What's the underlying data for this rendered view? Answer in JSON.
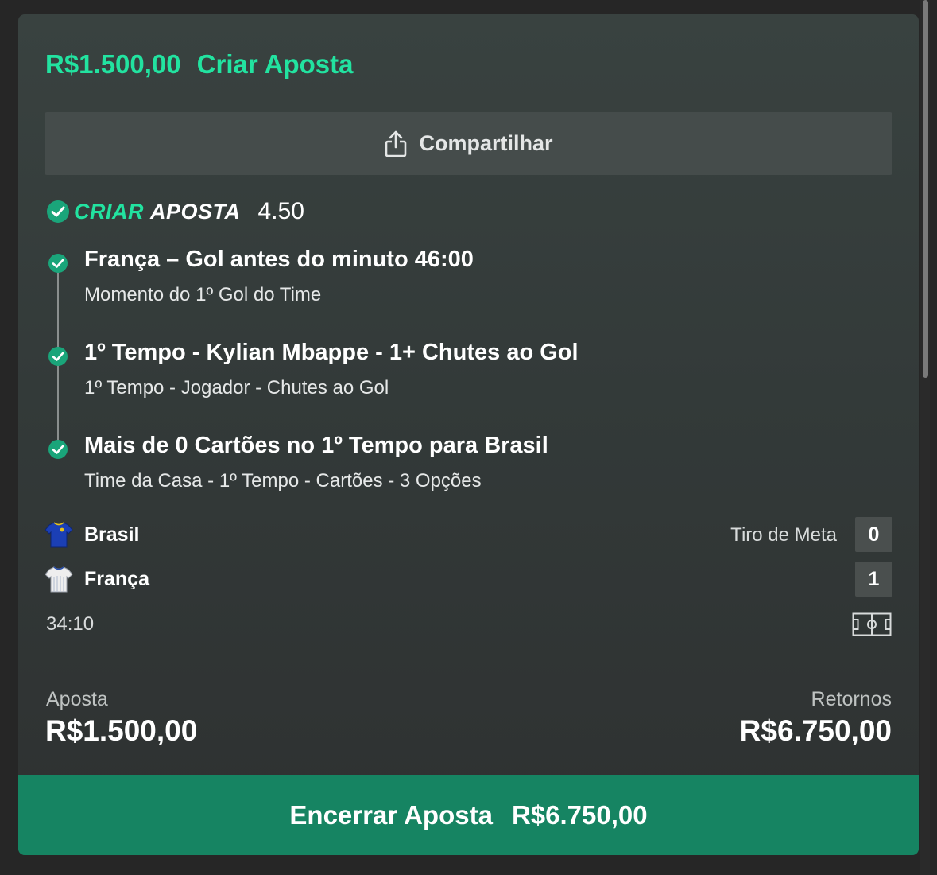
{
  "header": {
    "amount": "R$1.500,00",
    "title": "Criar Aposta"
  },
  "share_button": {
    "label": "Compartilhar",
    "icon": "share-icon"
  },
  "bet_builder": {
    "badge_word1": "CRIAR",
    "badge_word2": "APOSTA",
    "odds": "4.50",
    "icon": "check-circle-icon"
  },
  "selections": [
    {
      "title": "França – Gol antes do minuto 46:00",
      "subtitle": "Momento do 1º Gol do Time"
    },
    {
      "title": "1º Tempo - Kylian Mbappe - 1+ Chutes ao Gol",
      "subtitle": "1º Tempo - Jogador - Chutes ao Gol"
    },
    {
      "title": "Mais de 0 Cartões no 1º Tempo para Brasil",
      "subtitle": "Time da Casa - 1º Tempo - Cartões - 3 Opções"
    }
  ],
  "match": {
    "stat_label": "Tiro de Meta",
    "teams": [
      {
        "name": "Brasil",
        "score": "0",
        "shirt_color": "#1b3fb5"
      },
      {
        "name": "França",
        "score": "1",
        "shirt_color": "#eeeeee"
      }
    ],
    "clock": "34:10",
    "pitch_icon": "pitch-icon"
  },
  "summary": {
    "stake_label": "Aposta",
    "stake_value": "R$1.500,00",
    "returns_label": "Retornos",
    "returns_value": "R$6.750,00"
  },
  "cashout": {
    "label": "Encerrar Aposta",
    "value": "R$6.750,00"
  },
  "colors": {
    "accent": "#22e3a0",
    "cashout_bg": "#168462",
    "check": "#1aa57a"
  }
}
